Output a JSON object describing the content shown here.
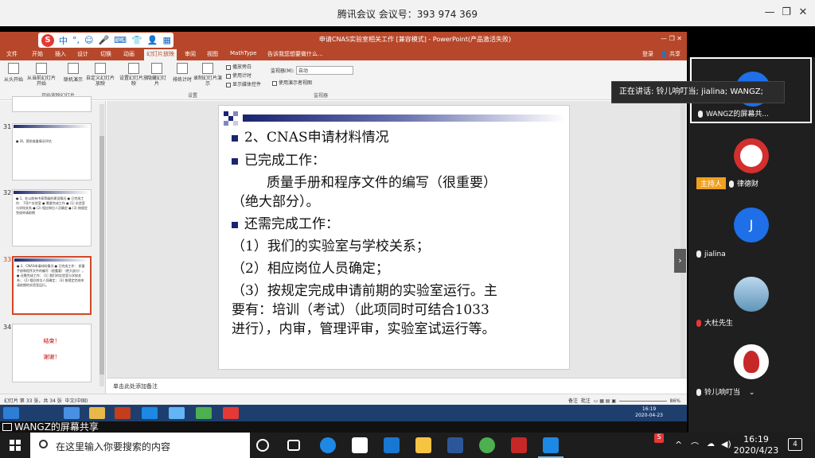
{
  "meeting": {
    "title": "腾讯会议 会议号：393 974 369"
  },
  "ppt": {
    "window_title": "申请CNAS实验室相关工作 [兼容模式] - PowerPoint(产品激活失败)",
    "tabs": [
      "文件",
      "开始",
      "插入",
      "设计",
      "切换",
      "动画",
      "幻灯片放映",
      "审阅",
      "视图",
      "MathType",
      "告诉我您想要做什么..."
    ],
    "active_tab": "幻灯片放映",
    "login": "登录",
    "share": "共享",
    "ribbon": {
      "buttons": [
        "从头开始",
        "从当前幻灯片开始",
        "联机演示",
        "自定义幻灯片放映",
        "设置幻灯片放映",
        "隐藏幻灯片",
        "排练计时",
        "录制幻灯片演示"
      ],
      "checkboxes": [
        "播放旁白",
        "使用计时",
        "显示媒体控件"
      ],
      "monitor_label": "监视器(M):",
      "monitor_value": "自动",
      "presenter_view": "使用演示者视图",
      "groups": [
        "开始放映幻灯片",
        "设置",
        "监视器"
      ]
    },
    "thumbnails": [
      {
        "num": "31",
        "text": "● 四、营前准备情况评估"
      },
      {
        "num": "32",
        "text": "● 1、在以前有中高等级的建设情况 ● 已完成工作： 7项个实验室 ● 需要完成工作 ● (1) 实验室与学校关系 ● (2) 相应岗位人员确定 ● (3) 按规定完成申请前期"
      },
      {
        "num": "33",
        "text": "● 2、CNAS申请材料情况 ● 已完成工作： 质量手册和程序文件的编写（很重要）（绝大部分）。 ● 还需完成工作： (1) 我们的实验室与学校关系； (2) 相应岗位人员确定； (3) 按规定完成申请前期的实验室运行。"
      },
      {
        "num": "34",
        "text1": "结束！",
        "text2": "谢谢！"
      }
    ],
    "slide": {
      "heading": "2、CNAS申请材料情况",
      "b1": "已完成工作：",
      "l1": "质量手册和程序文件的编写（很重要）",
      "l2": "（绝大部分）。",
      "b2": "还需完成工作：",
      "l3": "（1）我们的实验室与学校关系；",
      "l4": "（2）相应岗位人员确定；",
      "l5": "（3）按规定完成申请前期的实验室运行。主",
      "l6": "要有：培训（考试）（此项同时可结合1033",
      "l7": "进行），内审，管理评审，实验室试运行等。"
    },
    "notes_placeholder": "单击此处添加备注",
    "status_left": "幻灯片 第 33 张，共 34 张",
    "status_lang": "中文(中国)",
    "status_notes": "备注",
    "status_comments": "批注",
    "zoom": "86%",
    "inner_time": "16:19",
    "inner_date": "2020-04-23"
  },
  "share_label": "WANGZ的屏幕共享",
  "speaking_tooltip": "正在讲话: 铃儿响叮当; jialina; WANGZ;",
  "participants": [
    {
      "name": "WANGZ的屏幕共...",
      "avatar_color": "#1e6fe8"
    },
    {
      "name": "律德财",
      "host_badge": "主持人",
      "avatar_color": "#d32f2f"
    },
    {
      "name": "jialina",
      "initial": "J",
      "avatar_color": "#1e6fe8"
    },
    {
      "name": "大杜先生",
      "avatar_color": "#7fb0d0"
    },
    {
      "name": "铃儿响叮当",
      "avatar_color": "#c62828"
    }
  ],
  "taskbar": {
    "search_placeholder": "在这里输入你要搜索的内容",
    "time": "16:19",
    "date": "2020/4/23",
    "notifications": "4"
  }
}
